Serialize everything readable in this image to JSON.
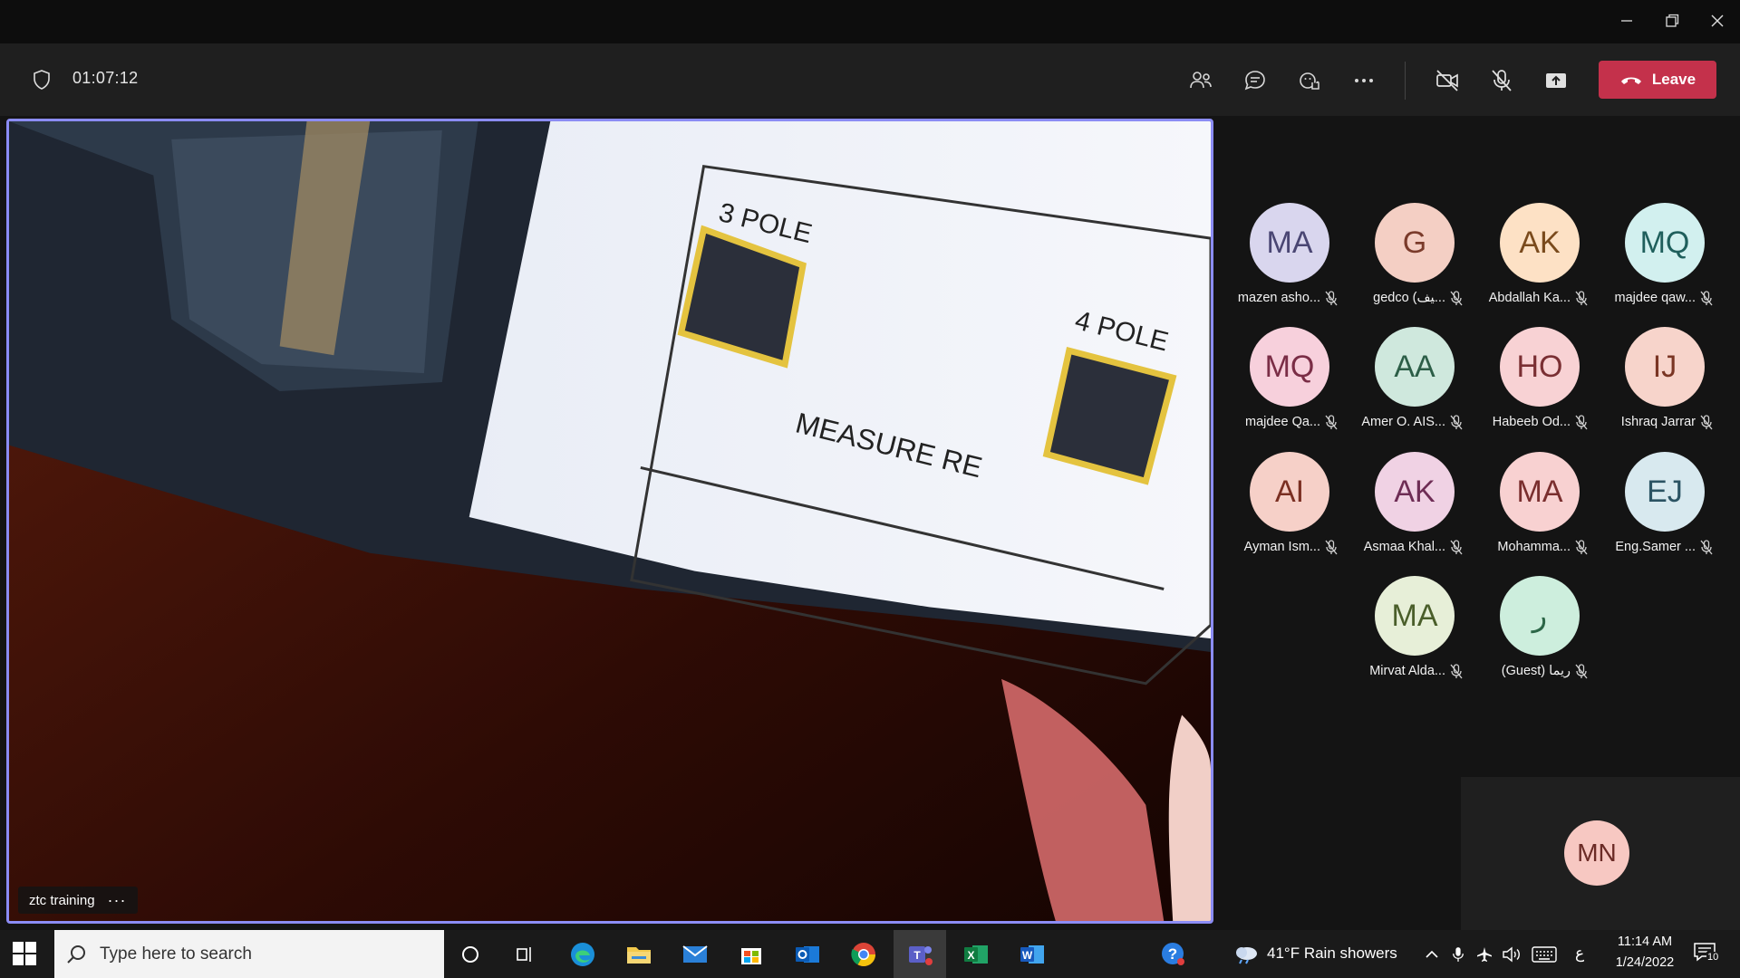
{
  "meeting": {
    "timer": "01:07:12",
    "leave_label": "Leave"
  },
  "video": {
    "label": "ztc training",
    "more": "···",
    "printed_labels": [
      "3 POLE",
      "4 POLE",
      "MEASURE RE"
    ]
  },
  "participants": [
    {
      "initials": "MA",
      "name": "mazen asho...",
      "color": "#d9d6ee",
      "text_color": "#4a4673"
    },
    {
      "initials": "G",
      "name": "gedco (ﻴﻒ...",
      "color": "#f4cfc4",
      "text_color": "#7a3b2b"
    },
    {
      "initials": "AK",
      "name": "Abdallah Ka...",
      "color": "#fde1c5",
      "text_color": "#7a4a1c"
    },
    {
      "initials": "MQ",
      "name": "majdee qaw...",
      "color": "#d2f0ef",
      "text_color": "#1f5f5c"
    },
    {
      "initials": "MQ",
      "name": "majdee Qa...",
      "color": "#f7d0dc",
      "text_color": "#7a2d46"
    },
    {
      "initials": "AA",
      "name": "Amer O. AIS...",
      "color": "#cfe8dd",
      "text_color": "#2c5e47"
    },
    {
      "initials": "HO",
      "name": "Habeeb Od...",
      "color": "#f8d2d4",
      "text_color": "#7a2f33"
    },
    {
      "initials": "IJ",
      "name": "Ishraq Jarrar",
      "color": "#f7d4cb",
      "text_color": "#7a3524"
    },
    {
      "initials": "AI",
      "name": "Ayman Ism...",
      "color": "#f6d0c8",
      "text_color": "#7a2f22"
    },
    {
      "initials": "AK",
      "name": "Asmaa Khal...",
      "color": "#f0d2e4",
      "text_color": "#6e2d55"
    },
    {
      "initials": "MA",
      "name": "Mohamma...",
      "color": "#f8d1d1",
      "text_color": "#7a2e2e"
    },
    {
      "initials": "EJ",
      "name": "Eng.Samer ...",
      "color": "#d8e9ef",
      "text_color": "#2b5363"
    },
    {
      "initials": "MA",
      "name": "Mirvat Alda...",
      "color": "#e7efd8",
      "text_color": "#4a5e2a"
    },
    {
      "initials": "ر",
      "name": "(Guest) ريما",
      "color": "#cdeedd",
      "text_color": "#2c6647"
    }
  ],
  "self": {
    "initials": "MN"
  },
  "taskbar": {
    "search_placeholder": "Type here to search",
    "weather": "41°F  Rain showers",
    "lang": "ع",
    "time": "11:14 AM",
    "date": "1/24/2022",
    "notifications": "10"
  },
  "colors": {
    "accent_border": "#8b8cf4",
    "leave": "#c4314b"
  }
}
